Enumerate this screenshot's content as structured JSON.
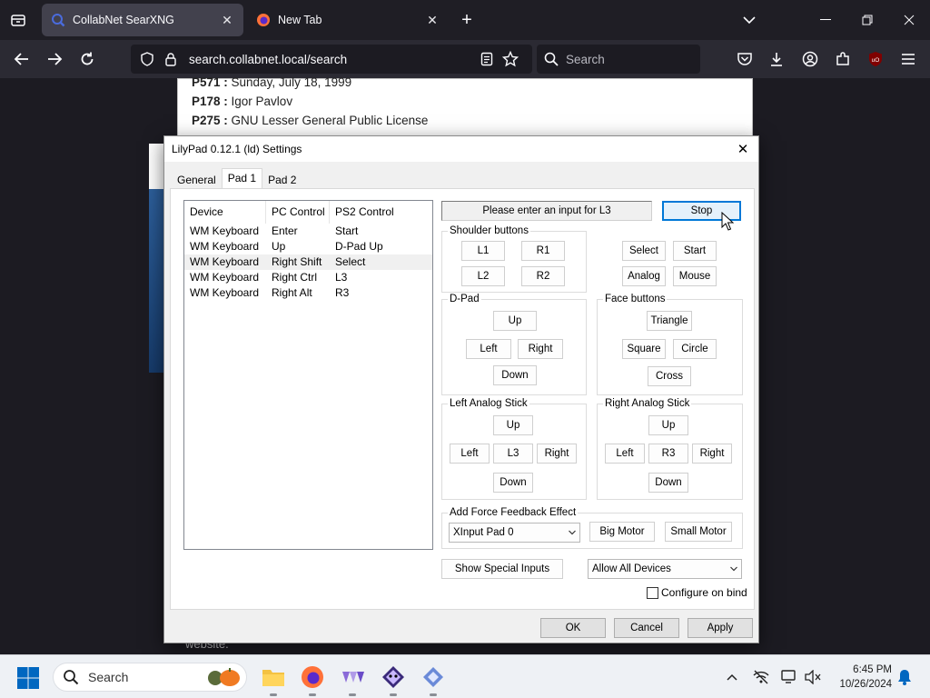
{
  "browser": {
    "tabs": [
      {
        "title": "CollabNet SearXNG",
        "active": true,
        "icon": "searxng-icon"
      },
      {
        "title": "New Tab",
        "active": false,
        "icon": "firefox-icon"
      }
    ],
    "url": "search.collabnet.local/search",
    "search_placeholder": "Search"
  },
  "page": {
    "result_lines": [
      {
        "key": "P571 :",
        "value": " Sunday, July 18, 1999"
      },
      {
        "key": "P178 :",
        "value": " Igor Pavlov"
      },
      {
        "key": "P275 :",
        "value": " GNU Lesser General Public License"
      }
    ],
    "behind_text": "website."
  },
  "dialog": {
    "title": "LilyPad 0.12.1 (ld) Settings",
    "close_label": "✕",
    "tabs": [
      "General",
      "Pad 1",
      "Pad 2"
    ],
    "selected_tab": "Pad 1",
    "list": {
      "headers": [
        "Device",
        "PC Control",
        "PS2 Control"
      ],
      "rows": [
        [
          "WM Keyboard",
          "Enter",
          "Start"
        ],
        [
          "WM Keyboard",
          "Up",
          "D-Pad Up"
        ],
        [
          "WM Keyboard",
          "Right Shift",
          "Select"
        ],
        [
          "WM Keyboard",
          "Right Ctrl",
          "L3"
        ],
        [
          "WM Keyboard",
          "Right Alt",
          "R3"
        ]
      ],
      "selected_row": 2
    },
    "status_text": "Please enter an input for L3",
    "stop_label": "Stop",
    "shoulder": {
      "label": "Shoulder buttons",
      "l1": "L1",
      "r1": "R1",
      "l2": "L2",
      "r2": "R2"
    },
    "misc": {
      "select": "Select",
      "start": "Start",
      "analog": "Analog",
      "mouse": "Mouse"
    },
    "dpad": {
      "label": "D-Pad",
      "up": "Up",
      "left": "Left",
      "right": "Right",
      "down": "Down"
    },
    "face": {
      "label": "Face buttons",
      "triangle": "Triangle",
      "square": "Square",
      "circle": "Circle",
      "cross": "Cross"
    },
    "left_stick": {
      "label": "Left Analog Stick",
      "up": "Up",
      "left": "Left",
      "center": "L3",
      "right": "Right",
      "down": "Down"
    },
    "right_stick": {
      "label": "Right Analog Stick",
      "up": "Up",
      "left": "Left",
      "center": "R3",
      "right": "Right",
      "down": "Down"
    },
    "force_feedback": {
      "label": "Add Force Feedback Effect",
      "device": "XInput Pad 0",
      "big_motor": "Big Motor",
      "small_motor": "Small Motor"
    },
    "show_special": "Show Special Inputs",
    "device_filter": "Allow All Devices",
    "configure_on_bind": "Configure on bind",
    "ok": "OK",
    "cancel": "Cancel",
    "apply": "Apply"
  },
  "taskbar": {
    "search_placeholder": "Search",
    "time": "6:45 PM",
    "date": "10/26/2024"
  },
  "colors": {
    "accent": "#0078d7",
    "browser_dark": "#1c1b22"
  }
}
